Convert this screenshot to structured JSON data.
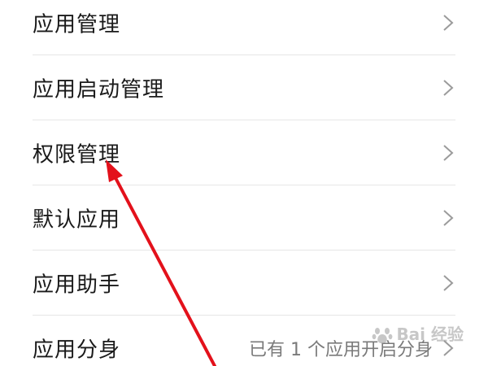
{
  "menu": {
    "items": [
      {
        "label": "应用管理",
        "value": ""
      },
      {
        "label": "应用启动管理",
        "value": ""
      },
      {
        "label": "权限管理",
        "value": ""
      },
      {
        "label": "默认应用",
        "value": ""
      },
      {
        "label": "应用助手",
        "value": ""
      },
      {
        "label": "应用分身",
        "value": "已有 1 个应用开启分身"
      }
    ]
  },
  "annotation": {
    "color": "#e3111b",
    "icon": "red-arrow-icon"
  },
  "watermark": {
    "text": "Bai 经验",
    "icon": "baidu-paw-icon"
  }
}
